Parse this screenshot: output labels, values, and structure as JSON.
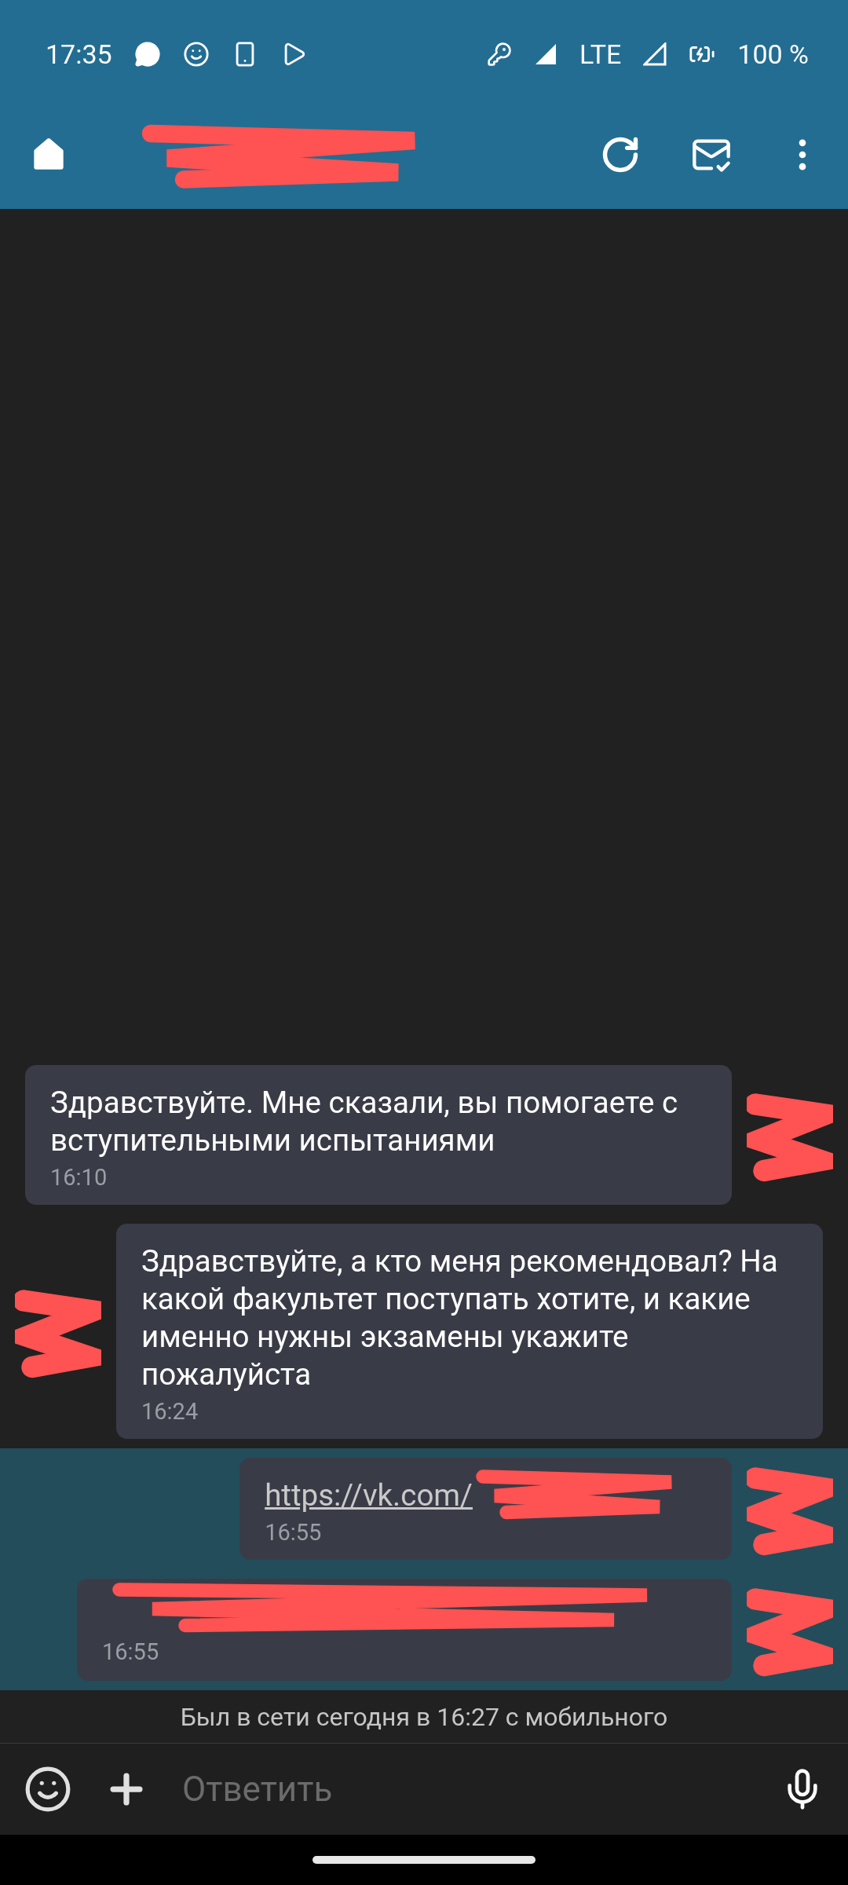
{
  "status_bar": {
    "time": "17:35",
    "network": "LTE",
    "battery": "100 %"
  },
  "messages": [
    {
      "outgoing": true,
      "unread": false,
      "text": "Здравствуйте. Мне сказали, вы помогаете с вступительными испытаниями",
      "time": "16:10"
    },
    {
      "outgoing": false,
      "unread": false,
      "text": "Здравствуйте, а кто меня рекомендовал? На какой факультет поступать хотите, и какие именно нужны экзамены укажите пожалуйста",
      "time": "16:24"
    },
    {
      "outgoing": true,
      "unread": true,
      "link": "https://vk.com/",
      "time": "16:55"
    },
    {
      "outgoing": true,
      "unread": true,
      "time": "16:55"
    }
  ],
  "last_seen": "Был в сети сегодня в 16:27 с мобильного",
  "composer": {
    "placeholder": "Ответить"
  }
}
